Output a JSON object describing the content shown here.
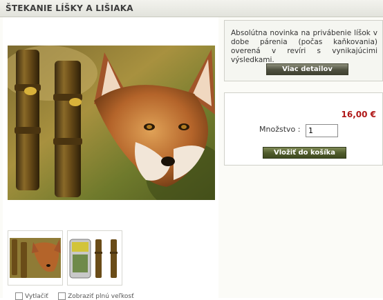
{
  "page": {
    "title": "ŠTEKANIE LÍŠKY A LIŠIAKA"
  },
  "description": {
    "text": "Absolútna novinka na privábenie líšok v dobe párenia (počas kaňkovania) overená v revíri s vynikajúcimi výsledkami.",
    "details_button": "Viac detailov"
  },
  "purchase": {
    "price": "16,00 €",
    "quantity_label": "Množstvo :",
    "quantity_value": "1",
    "add_to_cart_button": "Vložiť do košíka"
  },
  "image_options": {
    "print_label": "Vytlačiť",
    "full_size_label": "Zobraziť plnú veľkosť"
  },
  "icons": {
    "main": "fox-product-photo",
    "thumb1": "fox-product-thumbnail",
    "thumb2": "product-package-thumbnail"
  },
  "colors": {
    "price": "#b01818",
    "button": "#4f5140",
    "cart_button": "#4e5a2a"
  }
}
